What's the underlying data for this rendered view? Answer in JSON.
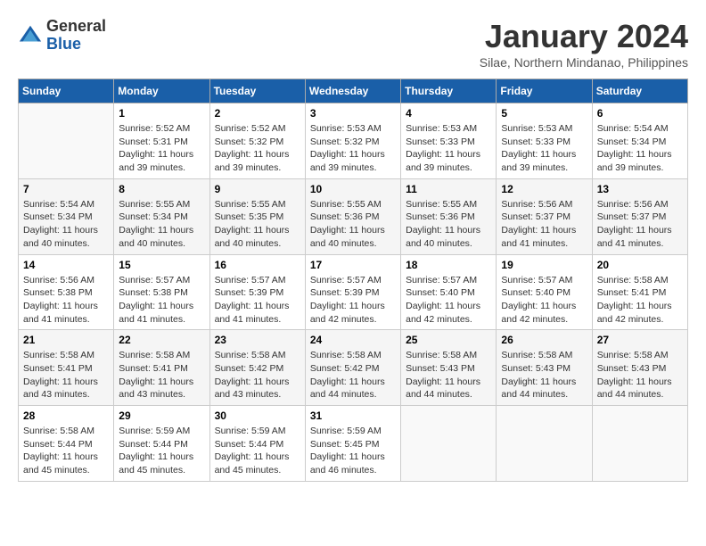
{
  "logo": {
    "general": "General",
    "blue": "Blue"
  },
  "header": {
    "month_year": "January 2024",
    "location": "Silae, Northern Mindanao, Philippines"
  },
  "weekdays": [
    "Sunday",
    "Monday",
    "Tuesday",
    "Wednesday",
    "Thursday",
    "Friday",
    "Saturday"
  ],
  "weeks": [
    [
      {
        "day": "",
        "info": ""
      },
      {
        "day": "1",
        "info": "Sunrise: 5:52 AM\nSunset: 5:31 PM\nDaylight: 11 hours\nand 39 minutes."
      },
      {
        "day": "2",
        "info": "Sunrise: 5:52 AM\nSunset: 5:32 PM\nDaylight: 11 hours\nand 39 minutes."
      },
      {
        "day": "3",
        "info": "Sunrise: 5:53 AM\nSunset: 5:32 PM\nDaylight: 11 hours\nand 39 minutes."
      },
      {
        "day": "4",
        "info": "Sunrise: 5:53 AM\nSunset: 5:33 PM\nDaylight: 11 hours\nand 39 minutes."
      },
      {
        "day": "5",
        "info": "Sunrise: 5:53 AM\nSunset: 5:33 PM\nDaylight: 11 hours\nand 39 minutes."
      },
      {
        "day": "6",
        "info": "Sunrise: 5:54 AM\nSunset: 5:34 PM\nDaylight: 11 hours\nand 39 minutes."
      }
    ],
    [
      {
        "day": "7",
        "info": "Sunrise: 5:54 AM\nSunset: 5:34 PM\nDaylight: 11 hours\nand 40 minutes."
      },
      {
        "day": "8",
        "info": "Sunrise: 5:55 AM\nSunset: 5:34 PM\nDaylight: 11 hours\nand 40 minutes."
      },
      {
        "day": "9",
        "info": "Sunrise: 5:55 AM\nSunset: 5:35 PM\nDaylight: 11 hours\nand 40 minutes."
      },
      {
        "day": "10",
        "info": "Sunrise: 5:55 AM\nSunset: 5:36 PM\nDaylight: 11 hours\nand 40 minutes."
      },
      {
        "day": "11",
        "info": "Sunrise: 5:55 AM\nSunset: 5:36 PM\nDaylight: 11 hours\nand 40 minutes."
      },
      {
        "day": "12",
        "info": "Sunrise: 5:56 AM\nSunset: 5:37 PM\nDaylight: 11 hours\nand 41 minutes."
      },
      {
        "day": "13",
        "info": "Sunrise: 5:56 AM\nSunset: 5:37 PM\nDaylight: 11 hours\nand 41 minutes."
      }
    ],
    [
      {
        "day": "14",
        "info": "Sunrise: 5:56 AM\nSunset: 5:38 PM\nDaylight: 11 hours\nand 41 minutes."
      },
      {
        "day": "15",
        "info": "Sunrise: 5:57 AM\nSunset: 5:38 PM\nDaylight: 11 hours\nand 41 minutes."
      },
      {
        "day": "16",
        "info": "Sunrise: 5:57 AM\nSunset: 5:39 PM\nDaylight: 11 hours\nand 41 minutes."
      },
      {
        "day": "17",
        "info": "Sunrise: 5:57 AM\nSunset: 5:39 PM\nDaylight: 11 hours\nand 42 minutes."
      },
      {
        "day": "18",
        "info": "Sunrise: 5:57 AM\nSunset: 5:40 PM\nDaylight: 11 hours\nand 42 minutes."
      },
      {
        "day": "19",
        "info": "Sunrise: 5:57 AM\nSunset: 5:40 PM\nDaylight: 11 hours\nand 42 minutes."
      },
      {
        "day": "20",
        "info": "Sunrise: 5:58 AM\nSunset: 5:41 PM\nDaylight: 11 hours\nand 42 minutes."
      }
    ],
    [
      {
        "day": "21",
        "info": "Sunrise: 5:58 AM\nSunset: 5:41 PM\nDaylight: 11 hours\nand 43 minutes."
      },
      {
        "day": "22",
        "info": "Sunrise: 5:58 AM\nSunset: 5:41 PM\nDaylight: 11 hours\nand 43 minutes."
      },
      {
        "day": "23",
        "info": "Sunrise: 5:58 AM\nSunset: 5:42 PM\nDaylight: 11 hours\nand 43 minutes."
      },
      {
        "day": "24",
        "info": "Sunrise: 5:58 AM\nSunset: 5:42 PM\nDaylight: 11 hours\nand 44 minutes."
      },
      {
        "day": "25",
        "info": "Sunrise: 5:58 AM\nSunset: 5:43 PM\nDaylight: 11 hours\nand 44 minutes."
      },
      {
        "day": "26",
        "info": "Sunrise: 5:58 AM\nSunset: 5:43 PM\nDaylight: 11 hours\nand 44 minutes."
      },
      {
        "day": "27",
        "info": "Sunrise: 5:58 AM\nSunset: 5:43 PM\nDaylight: 11 hours\nand 44 minutes."
      }
    ],
    [
      {
        "day": "28",
        "info": "Sunrise: 5:58 AM\nSunset: 5:44 PM\nDaylight: 11 hours\nand 45 minutes."
      },
      {
        "day": "29",
        "info": "Sunrise: 5:59 AM\nSunset: 5:44 PM\nDaylight: 11 hours\nand 45 minutes."
      },
      {
        "day": "30",
        "info": "Sunrise: 5:59 AM\nSunset: 5:44 PM\nDaylight: 11 hours\nand 45 minutes."
      },
      {
        "day": "31",
        "info": "Sunrise: 5:59 AM\nSunset: 5:45 PM\nDaylight: 11 hours\nand 46 minutes."
      },
      {
        "day": "",
        "info": ""
      },
      {
        "day": "",
        "info": ""
      },
      {
        "day": "",
        "info": ""
      }
    ]
  ]
}
